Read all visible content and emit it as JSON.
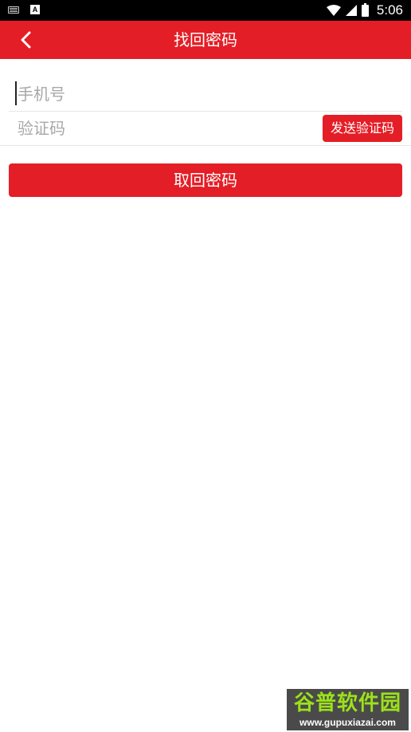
{
  "status_bar": {
    "time": "5:06",
    "left_icons": [
      "keyboard-icon",
      "a-icon"
    ],
    "a_icon_letter": "A",
    "right_icons": [
      "wifi-icon",
      "signal-icon",
      "battery-icon"
    ]
  },
  "header": {
    "title": "找回密码",
    "back_icon": "chevron-left-icon",
    "color": "#e41e26"
  },
  "form": {
    "phone": {
      "placeholder": "手机号",
      "value": ""
    },
    "code": {
      "placeholder": "验证码",
      "value": ""
    },
    "send_code_label": "发送验证码",
    "submit_label": "取回密码"
  },
  "watermark": {
    "name": "谷普软件园",
    "url": "www.gupuxiazai.com"
  }
}
